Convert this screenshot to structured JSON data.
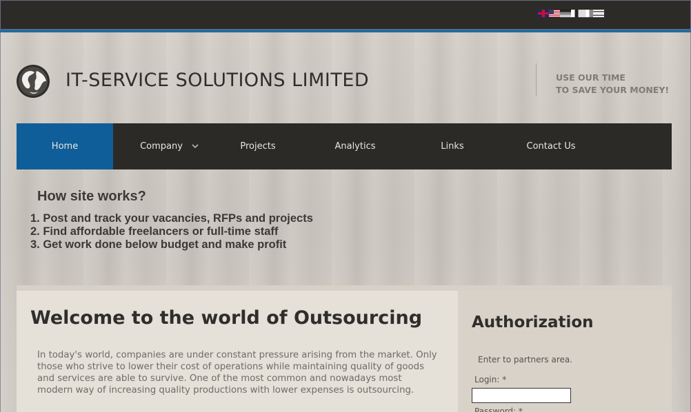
{
  "header": {
    "languages": [
      "English (UK)",
      "English (US)",
      "German",
      "French",
      "Italian",
      "Hebrew"
    ],
    "brand": "IT-SERVICE SOLUTIONS LIMITED",
    "slogan_line1": "USE OUR TIME",
    "slogan_line2": "TO SAVE YOUR MONEY!"
  },
  "nav": {
    "items": [
      {
        "label": "Home",
        "active": true
      },
      {
        "label": "Company",
        "has_dropdown": true
      },
      {
        "label": "Projects"
      },
      {
        "label": "Analytics"
      },
      {
        "label": "Links"
      },
      {
        "label": "Contact Us"
      }
    ]
  },
  "how": {
    "title": "How site works?",
    "steps": [
      "1. Post and track your vacancies, RFPs and projects",
      "2. Find affordable freelancers or full-time staff",
      "3. Get work done below budget and make profit"
    ]
  },
  "main": {
    "welcome_title": "Welcome to the world of Outsourcing",
    "intro": "In today's world, companies are under constant pressure arising from the market. Only those who strive to lower their cost of operations while maintaining quality of goods and services are able to survive. One of the most common and nowadays most modern way of increasing quality productions with lower expenses is outsourcing."
  },
  "auth": {
    "title": "Authorization",
    "note": "Enter to partners area.",
    "login_label": "Login:",
    "password_label": "Password:",
    "required_mark": "*",
    "login_value": ""
  },
  "colors": {
    "nav_active": "#0f5e99",
    "nav_bg": "#2b2a27",
    "topbar": "#2c2b28",
    "accent_stripe": "#1f6ea3"
  }
}
